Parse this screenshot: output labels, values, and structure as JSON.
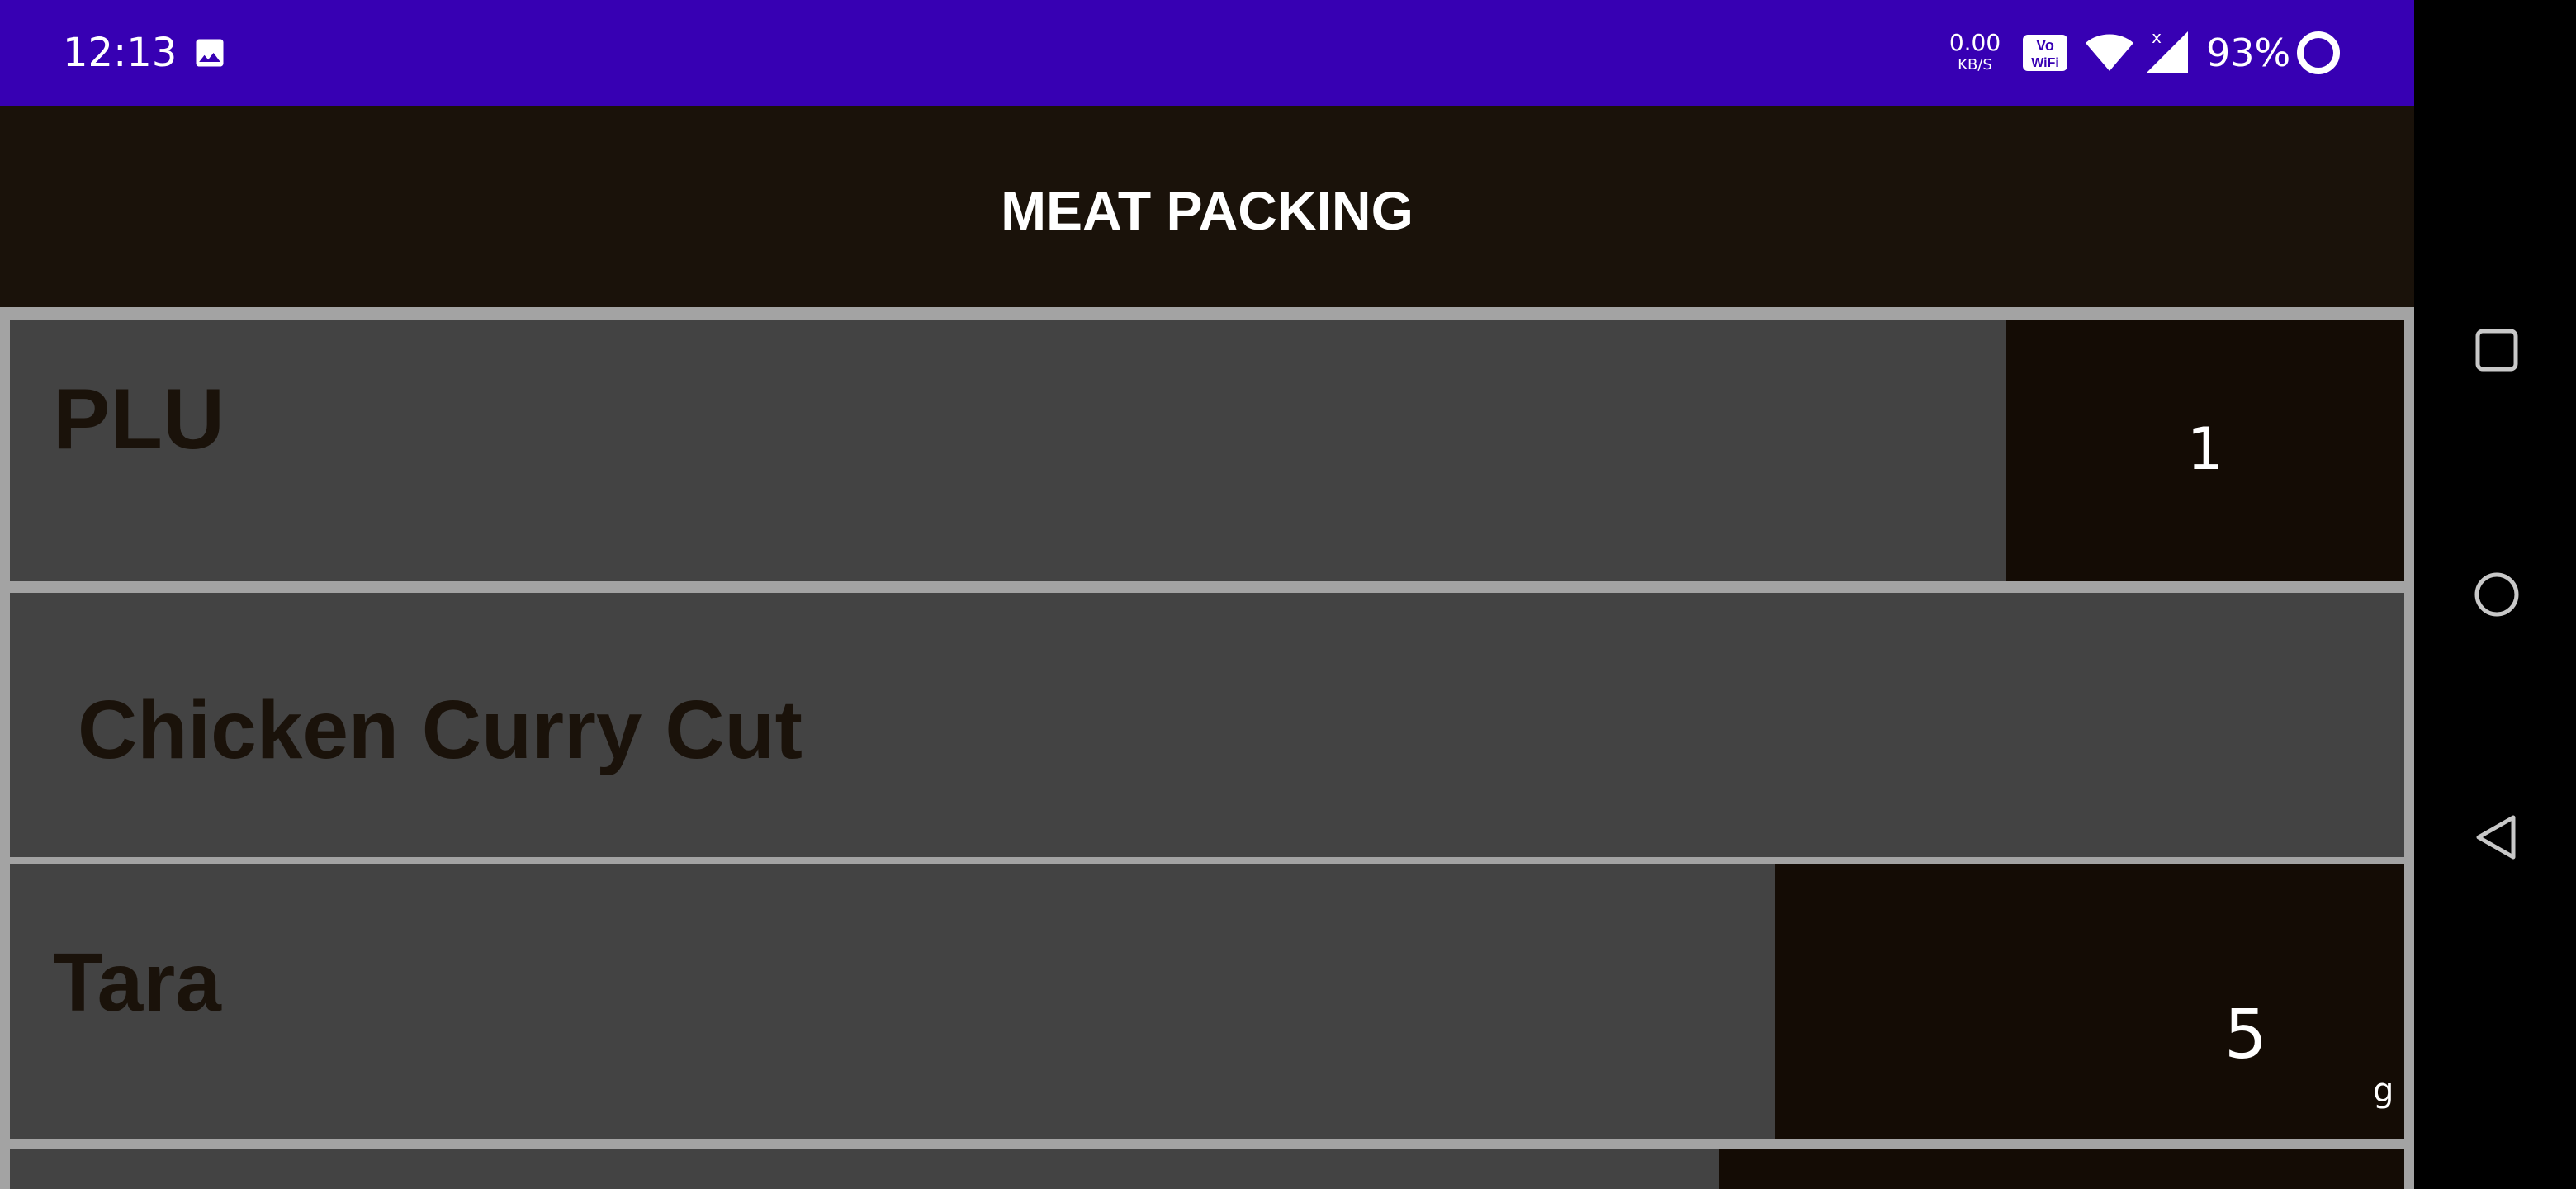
{
  "status_bar": {
    "time": "12:13",
    "net_speed_value": "0.00",
    "net_speed_unit": "KB/S",
    "battery_percent": "93%",
    "signal_badge": "x",
    "icons": [
      "image-icon",
      "vowifi-icon",
      "wifi-icon",
      "signal-icon",
      "battery-ring-icon"
    ],
    "background": "#3700b3"
  },
  "header": {
    "title": "MEAT PACKING",
    "background": "#1a120a"
  },
  "rows": {
    "plu": {
      "label": "PLU",
      "value": "1"
    },
    "product": {
      "label": "Chicken Curry Cut"
    },
    "tara": {
      "label": "Tara",
      "value": "5",
      "unit": "g"
    }
  },
  "nav_bar": {
    "buttons": [
      "recents-icon",
      "home-icon",
      "back-icon"
    ]
  },
  "colors": {
    "row_background": "#434343",
    "value_box_background": "#140c05",
    "page_background": "#a3a3a3",
    "label_text": "#1a120a"
  }
}
